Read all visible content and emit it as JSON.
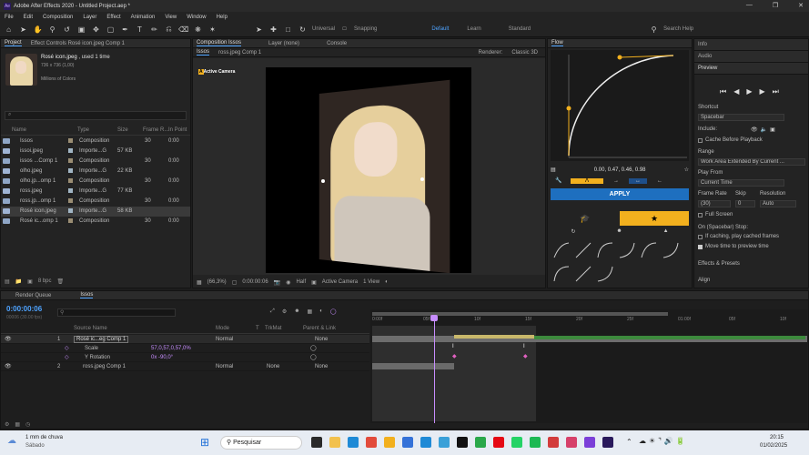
{
  "window": {
    "title": "Adobe After Effects 2020 - Untitled Project.aep *"
  },
  "menu": [
    "File",
    "Edit",
    "Composition",
    "Layer",
    "Effect",
    "Animation",
    "View",
    "Window",
    "Help"
  ],
  "toolbar": {
    "universal": "Universal",
    "snapping": "Snapping",
    "workspaces": [
      "Default",
      "Learn",
      "Standard"
    ],
    "search": "Search Help"
  },
  "project": {
    "tabs": [
      "Project",
      "Effect Controls Rosé icon.jpeg Comp 1"
    ],
    "item_name": "Rosé icon.jpeg",
    "item_used": ", used 1 time",
    "item_size": "736 x 736 (1,00)",
    "item_colors": "Millions of Colors",
    "search_placeholder": "⌕",
    "headers": [
      "Name",
      "Type",
      "Size",
      "Frame R...",
      "In Point"
    ],
    "items": [
      {
        "name": "Issos",
        "type": "Composition",
        "size": "",
        "fr": "30",
        "in": "0:00",
        "icon": "comp"
      },
      {
        "name": "issoi.jpeg",
        "type": "Importe...G",
        "size": "57 KB",
        "fr": "",
        "in": "",
        "icon": "img"
      },
      {
        "name": "issos ...Comp 1",
        "type": "Composition",
        "size": "",
        "fr": "30",
        "in": "0:00",
        "icon": "comp"
      },
      {
        "name": "olho.jpeg",
        "type": "Importe...G",
        "size": "22 KB",
        "fr": "",
        "in": "",
        "icon": "img"
      },
      {
        "name": "olho.jp...omp 1",
        "type": "Composition",
        "size": "",
        "fr": "30",
        "in": "0:00",
        "icon": "comp"
      },
      {
        "name": "ross.jpeg",
        "type": "Importe...G",
        "size": "77 KB",
        "fr": "",
        "in": "",
        "icon": "img"
      },
      {
        "name": "ross.jp...omp 1",
        "type": "Composition",
        "size": "",
        "fr": "30",
        "in": "0:00",
        "icon": "comp"
      },
      {
        "name": "Rosé icon.jpeg",
        "type": "Importe...G",
        "size": "58 KB",
        "fr": "",
        "in": "",
        "icon": "img"
      },
      {
        "name": "Rosé ic...omp 1",
        "type": "Composition",
        "size": "",
        "fr": "30",
        "in": "0:00",
        "icon": "comp"
      }
    ],
    "bpc": "8 bpc"
  },
  "composition": {
    "tabs": [
      "Composition Issos",
      "Layer (none)",
      "Console"
    ],
    "subtabs": [
      "Issos",
      "ross.jpeg Comp 1"
    ],
    "renderer": "Renderer:",
    "renderer_value": "Classic 3D",
    "camera_label": "Active Camera",
    "zoom": "(66,3%)",
    "timecode": "0:00:00:06",
    "quality": "Half",
    "camera_dd": "Active Camera",
    "view": "1 View"
  },
  "flow": {
    "title": "Flow",
    "bezier": "0.00, 0.47, 0.46, 0.98",
    "apply": "APPLY"
  },
  "right": {
    "info": "Info",
    "audio": "Audio",
    "preview": "Preview",
    "shortcut_label": "Shortcut",
    "shortcut": "Spacebar",
    "include": "Include:",
    "cache": "Cache Before Playback",
    "range_label": "Range",
    "range": "Work Area Extended By Current ...",
    "playfrom_label": "Play From",
    "playfrom": "Current Time",
    "framerate_label": "Frame Rate",
    "skip_label": "Skip",
    "resolution_label": "Resolution",
    "framerate": "(30)",
    "skip": "0",
    "resolution": "Auto",
    "fullscreen": "Full Screen",
    "stop_label": "On (Spacebar) Stop:",
    "stop1": "If caching, play cached frames",
    "stop2": "Move time to preview time",
    "effects": "Effects & Presets",
    "align": "Align"
  },
  "timeline": {
    "tabs": [
      "Render Queue",
      "Issos"
    ],
    "timecode": "0:00:00:06",
    "fps": "00006 (30.00 fps)",
    "headers": [
      "Source Name",
      "Mode",
      "T",
      "TrkMat",
      "Parent & Link"
    ],
    "layers": [
      {
        "num": "1",
        "name": "Rosé ic...eg Comp 1",
        "mode": "Normal",
        "trk": "",
        "parent": "None"
      },
      {
        "num": "",
        "name": "Scale",
        "mode": "",
        "trk": "",
        "parent": "",
        "value": "57,0,57,0,57,0%"
      },
      {
        "num": "",
        "name": "Y Rotation",
        "mode": "",
        "trk": "",
        "parent": "",
        "value": "0x -90,0°"
      },
      {
        "num": "2",
        "name": "ross.jpeg Comp 1",
        "mode": "Normal",
        "trk": "None",
        "parent": "None"
      }
    ],
    "ruler": [
      "0:00f",
      "05f",
      "10f",
      "15f",
      "20f",
      "25f",
      "01:00f",
      "05f",
      "10f"
    ]
  },
  "taskbar": {
    "weather": "1 mm de chuva",
    "weather_sub": "Sábado",
    "search": "Pesquisar",
    "time": "20:15",
    "date": "01/02/2025"
  }
}
